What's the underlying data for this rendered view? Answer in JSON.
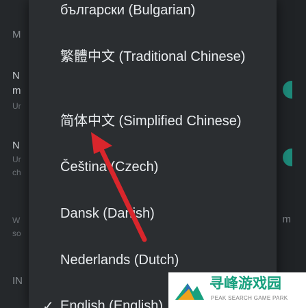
{
  "background": {
    "fragments": [
      {
        "text": "M"
      },
      {
        "text": "N"
      },
      {
        "text": "m"
      },
      {
        "text": "Ur"
      },
      {
        "text": "N"
      },
      {
        "text": "Ur"
      },
      {
        "text": "ch"
      },
      {
        "text": "W"
      },
      {
        "text": "so"
      },
      {
        "text": "IN"
      }
    ],
    "right_label": "m",
    "toggle_color": "#1e8a7a"
  },
  "languages": [
    {
      "label": "български (Bulgarian)"
    },
    {
      "label": "繁體中文 (Traditional Chinese)"
    },
    {
      "label": "简体中文 (Simplified Chinese)"
    },
    {
      "label": "Čeština (Czech)"
    },
    {
      "label": "Dansk (Danish)"
    },
    {
      "label": "Nederlands (Dutch)"
    },
    {
      "label": "English (English)",
      "selected": true
    }
  ],
  "check_glyph": "✓",
  "annotation": {
    "arrow_color": "#d9262c",
    "points_to": "简体中文 (Simplified Chinese)"
  },
  "watermark": {
    "title": "寻峰游戏园",
    "subtitle": "PEAK SEARCH GAME PARK",
    "brand_color": "#18a07e"
  }
}
